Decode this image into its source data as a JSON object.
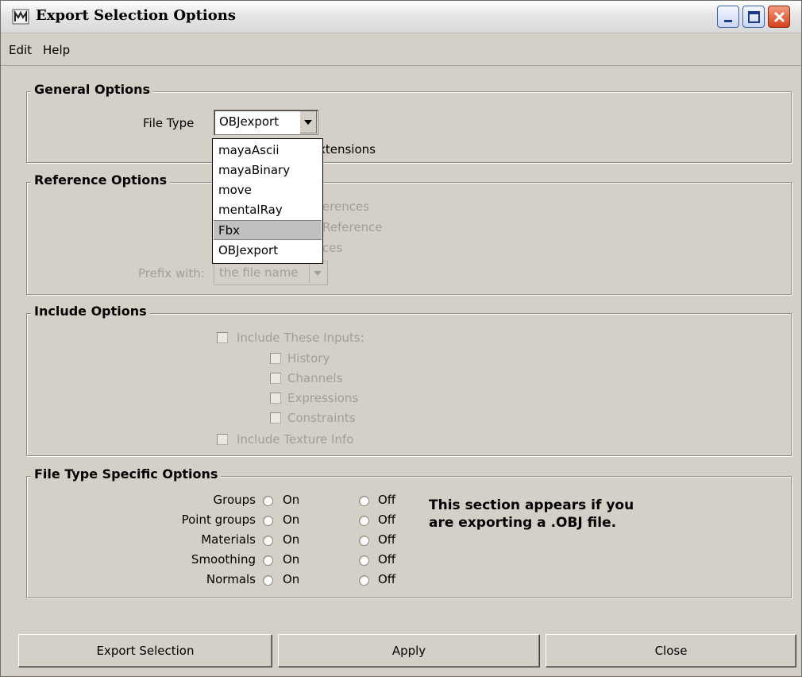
{
  "window": {
    "title": "Export Selection Options",
    "icon": "maya-app-icon",
    "controls": [
      "minimize-icon",
      "maximize-icon",
      "close-icon"
    ]
  },
  "menu": [
    "Edit",
    "Help"
  ],
  "general": {
    "title": "General Options",
    "file_type_label": "File Type",
    "file_type_value": "OBJexport",
    "extensions_text": "xtensions",
    "dropdown_options": [
      "mayaAscii",
      "mayaBinary",
      "move",
      "mentalRay",
      "Fbx",
      "OBJexport"
    ],
    "highlighted_option": "Fbx"
  },
  "reference": {
    "title": "Reference Options",
    "partial_1": "erences",
    "partial_2": "Reference",
    "partial_3": "ces",
    "prefix_label": "Prefix with:",
    "prefix_value": "the file name"
  },
  "include": {
    "title": "Include Options",
    "include_inputs": "Include These Inputs:",
    "history": "History",
    "channels": "Channels",
    "expressions": "Expressions",
    "constraints": "Constraints",
    "texture_info": "Include Texture Info"
  },
  "file_type_specific": {
    "title": "File Type Specific Options",
    "rows": [
      {
        "label": "Groups",
        "on": "On",
        "off": "Off"
      },
      {
        "label": "Point groups",
        "on": "On",
        "off": "Off"
      },
      {
        "label": "Materials",
        "on": "On",
        "off": "Off"
      },
      {
        "label": "Smoothing",
        "on": "On",
        "off": "Off"
      },
      {
        "label": "Normals",
        "on": "On",
        "off": "Off"
      }
    ],
    "note_line1": "This section appears if you",
    "note_line2": "are exporting a .OBJ file."
  },
  "buttons": {
    "export": "Export Selection",
    "apply": "Apply",
    "close": "Close"
  }
}
